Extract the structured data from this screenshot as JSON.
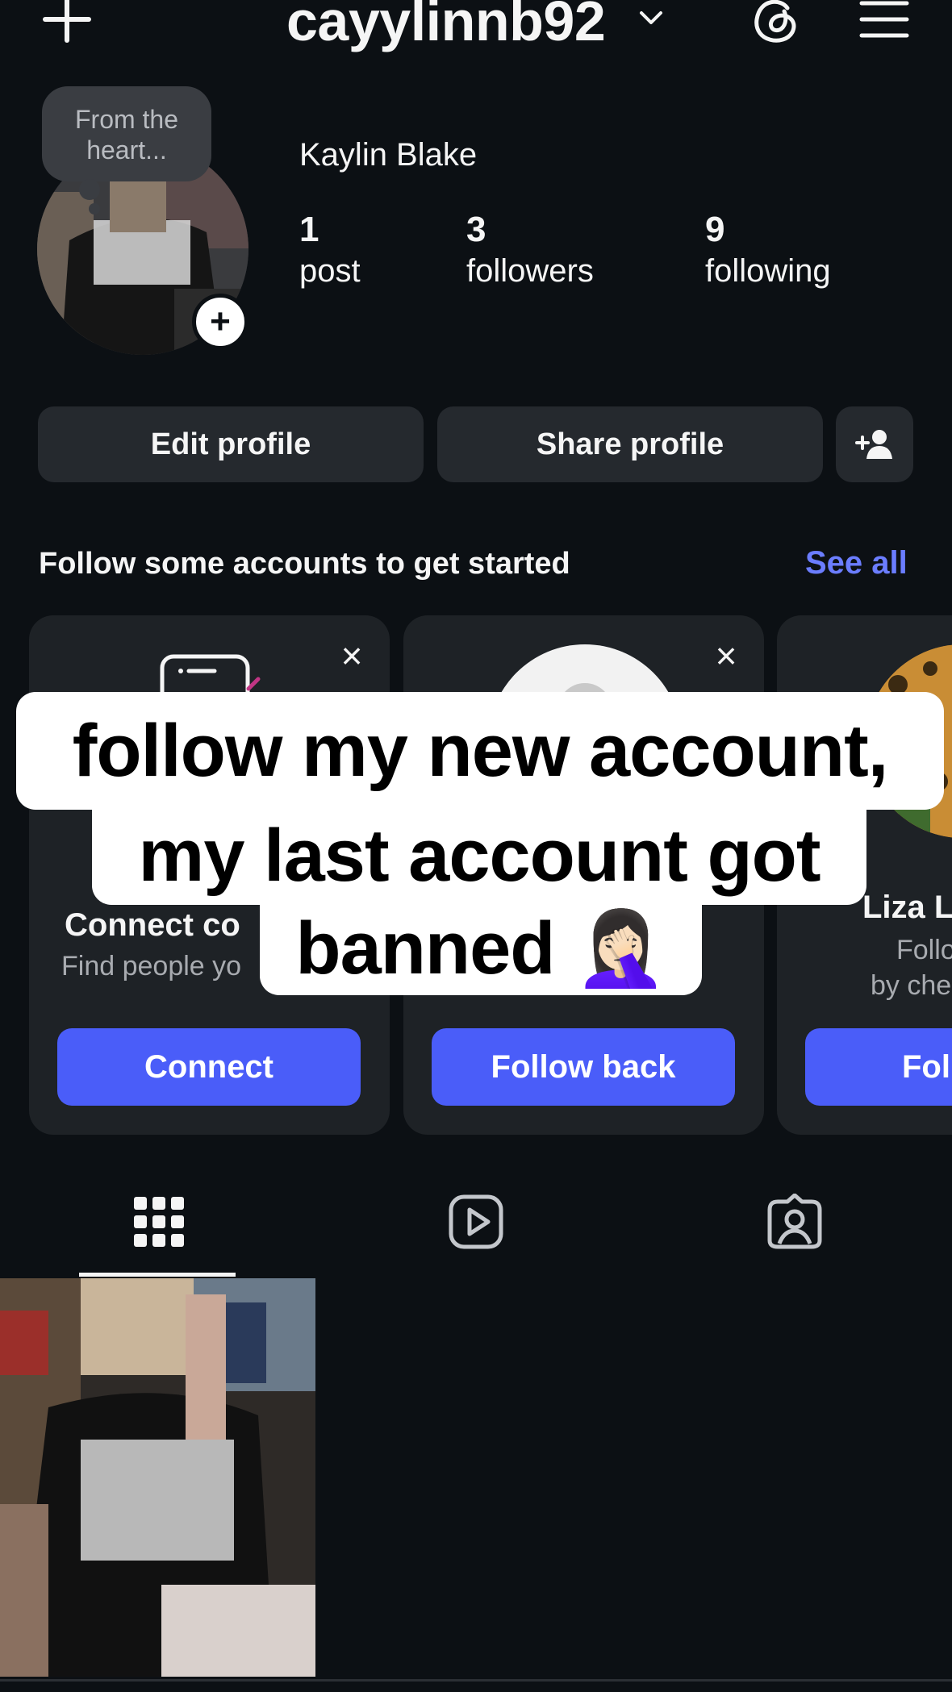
{
  "header": {
    "username": "cayylinnb92"
  },
  "profile": {
    "note": "From the heart...",
    "display_name": "Kaylin Blake",
    "stats": [
      {
        "value": "1",
        "label": "post"
      },
      {
        "value": "3",
        "label": "followers"
      },
      {
        "value": "9",
        "label": "following"
      }
    ]
  },
  "actions": {
    "edit": "Edit profile",
    "share": "Share profile"
  },
  "suggestions": {
    "title": "Follow some accounts to get started",
    "see_all": "See all",
    "cards": [
      {
        "title": "Connect co",
        "subtitle": "Find people yo",
        "button": "Connect"
      },
      {
        "title": "",
        "subtitle": "",
        "button": "Follow back"
      },
      {
        "title": "Liza L",
        "subtitle": "Follo",
        "subtitle2": "by che",
        "button": "Fol"
      }
    ]
  },
  "caption": {
    "line1": "follow my new account,",
    "line2": "my last account got",
    "line3": "banned 🤦🏻‍♀️"
  },
  "colors": {
    "background": "#0c1014",
    "accent": "#4a5df9",
    "link": "#6b7dff"
  }
}
